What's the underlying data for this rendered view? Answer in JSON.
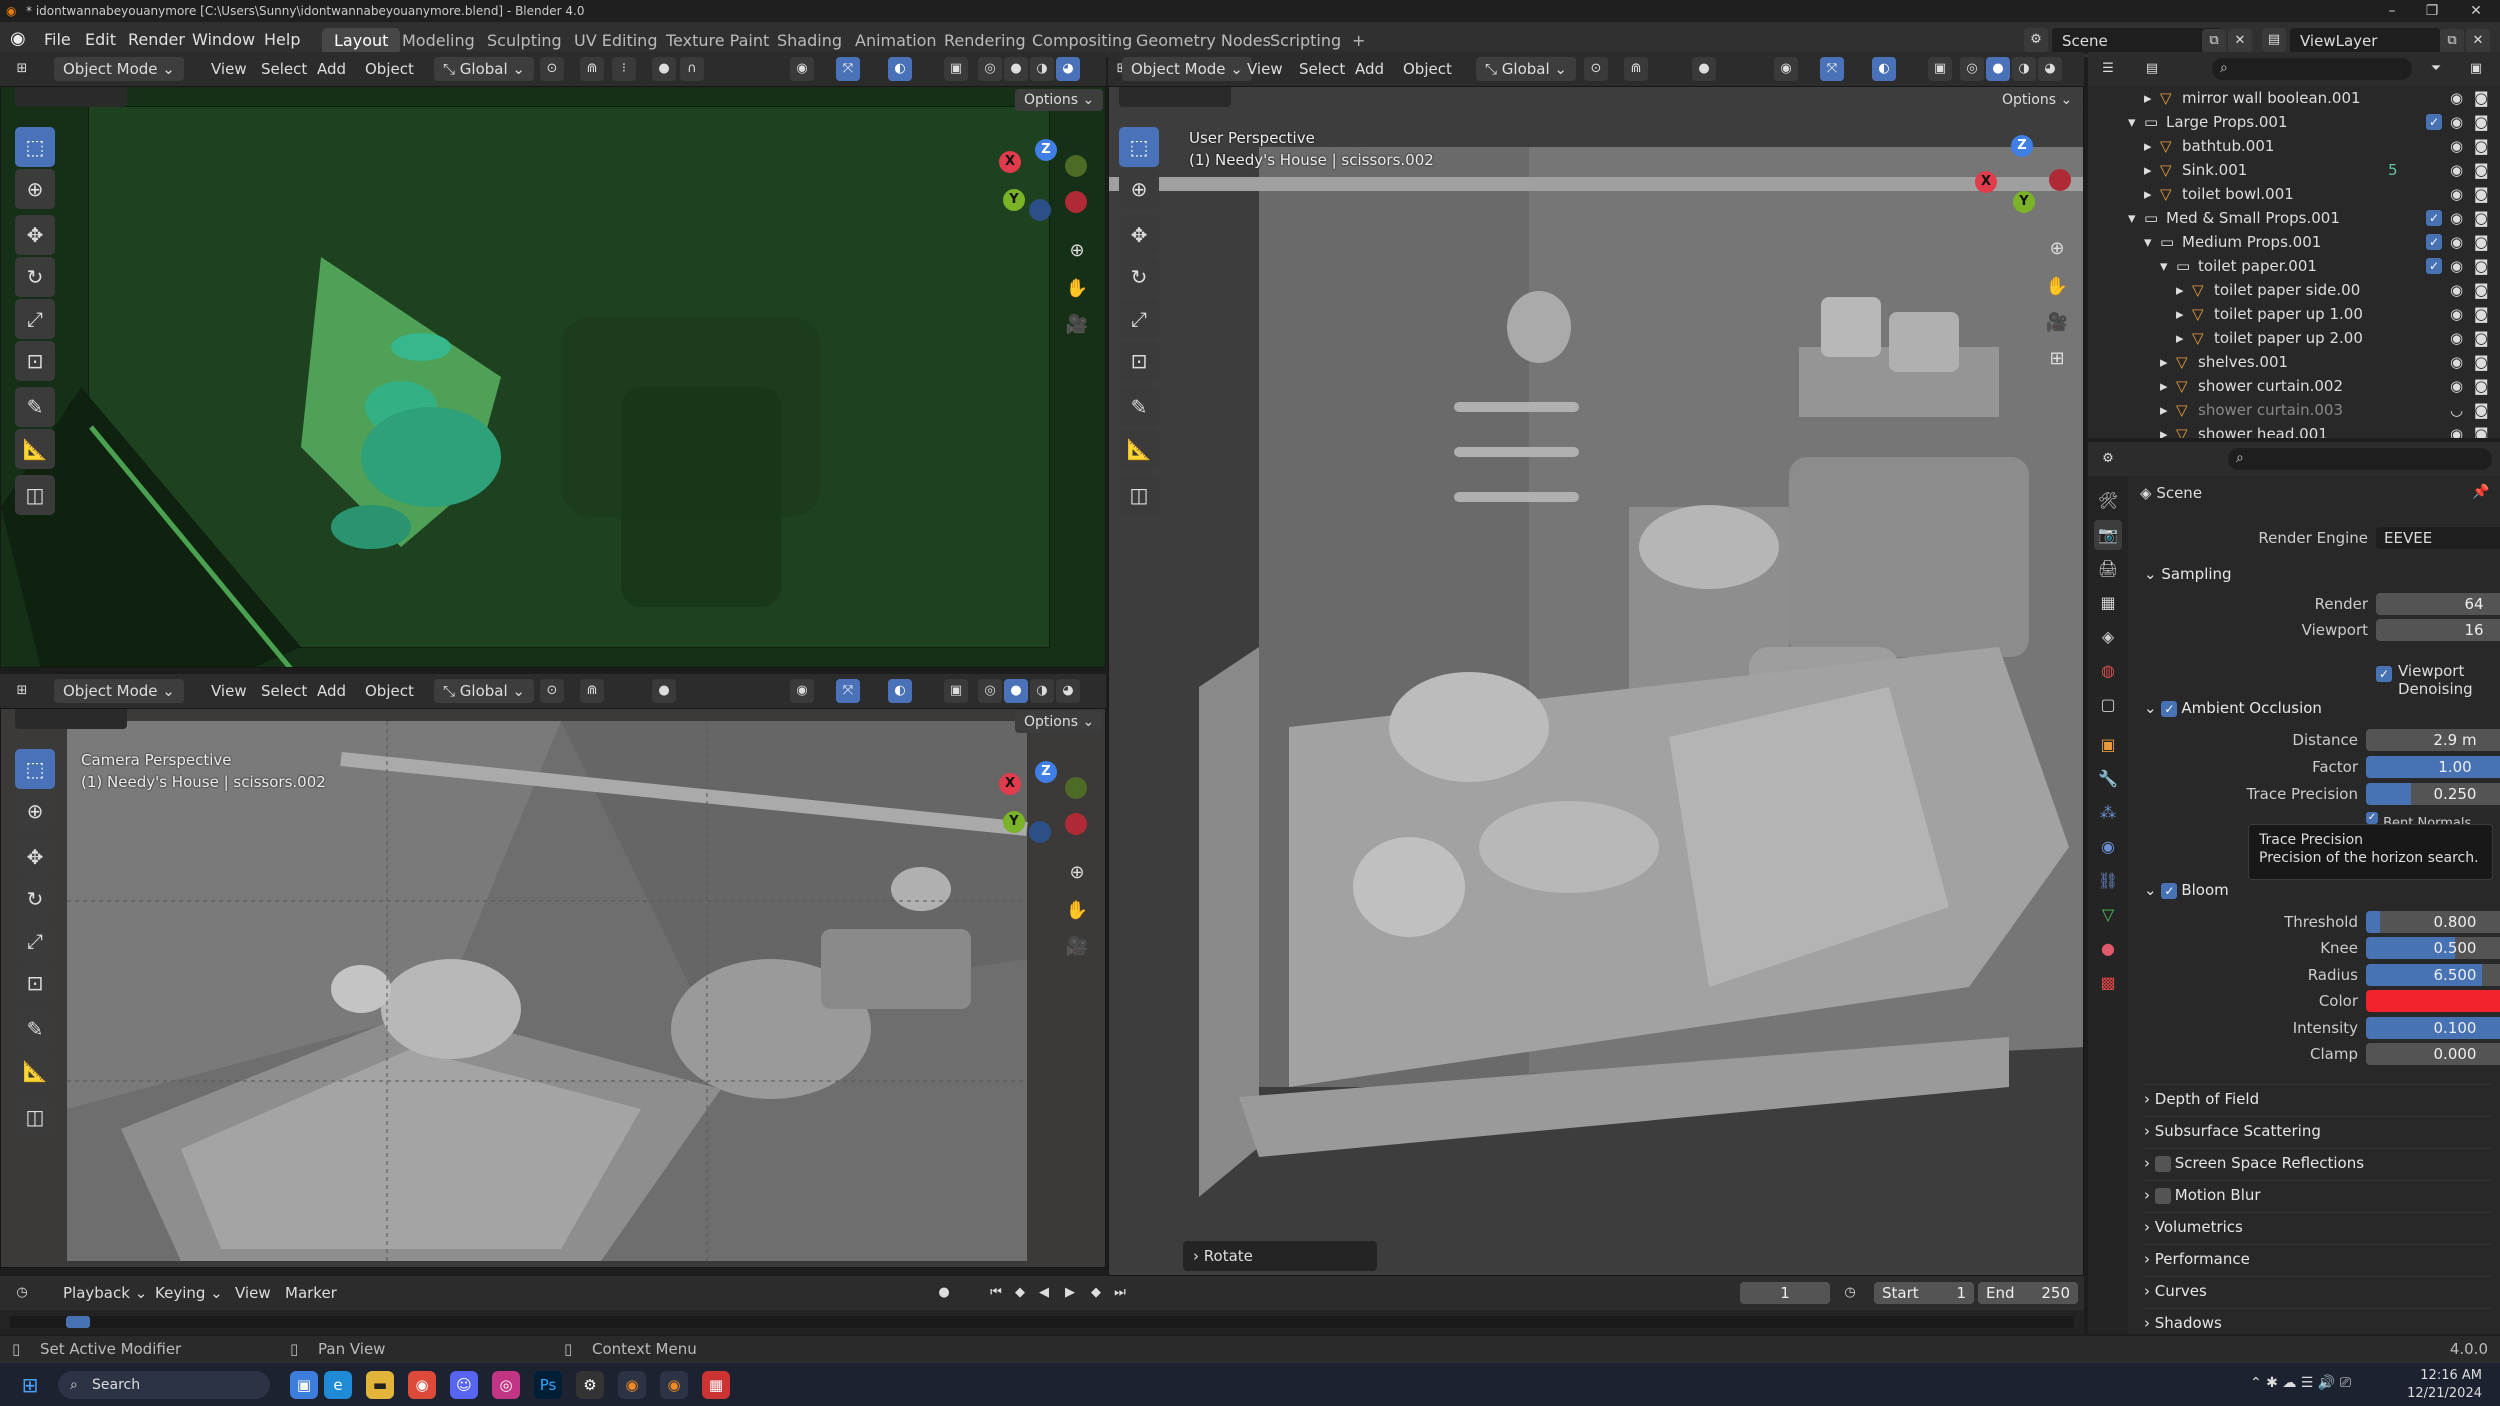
{
  "window": {
    "title": "* idontwannabeyouanymore [C:\\Users\\Sunny\\idontwannabeyouanymore.blend] - Blender 4.0",
    "controls": [
      "–",
      "❐",
      "✕"
    ]
  },
  "menu": [
    "File",
    "Edit",
    "Render",
    "Window",
    "Help"
  ],
  "workspaces": [
    {
      "label": "Layout",
      "active": true
    },
    {
      "label": "Modeling"
    },
    {
      "label": "Sculpting"
    },
    {
      "label": "UV Editing"
    },
    {
      "label": "Texture Paint"
    },
    {
      "label": "Shading"
    },
    {
      "label": "Animation"
    },
    {
      "label": "Rendering"
    },
    {
      "label": "Compositing"
    },
    {
      "label": "Geometry Nodes"
    },
    {
      "label": "Scripting"
    }
  ],
  "add_workspace": "+",
  "scene_selector": "Scene",
  "viewlayer_selector": "ViewLayer",
  "viewport_header": {
    "mode": "Object Mode",
    "menus": [
      "View",
      "Select",
      "Add",
      "Object"
    ],
    "orientation": "Global",
    "options": "Options"
  },
  "viewports": {
    "top_left": {
      "theme": "green"
    },
    "bottom_left": {
      "perspective": "Camera Perspective",
      "context": "(1) Needy's House | scissors.002"
    },
    "right": {
      "perspective": "User Perspective",
      "context": "(1) Needy's House | scissors.002"
    }
  },
  "gizmo": {
    "x": "X",
    "y": "Y",
    "z": "Z"
  },
  "last_operator": "Rotate",
  "outliner": {
    "rows": [
      {
        "indent": 3,
        "label": "mirror wall boolean.001",
        "type": "mesh"
      },
      {
        "indent": 2,
        "label": "Large Props.001",
        "type": "collection",
        "expanded": true
      },
      {
        "indent": 3,
        "label": "bathtub.001",
        "type": "mesh"
      },
      {
        "indent": 3,
        "label": "Sink.001",
        "type": "mesh",
        "badge": "5"
      },
      {
        "indent": 3,
        "label": "toilet bowl.001",
        "type": "mesh"
      },
      {
        "indent": 2,
        "label": "Med & Small Props.001",
        "type": "collection",
        "expanded": true
      },
      {
        "indent": 3,
        "label": "Medium Props.001",
        "type": "collection",
        "expanded": true
      },
      {
        "indent": 4,
        "label": "toilet paper.001",
        "type": "collection",
        "expanded": true
      },
      {
        "indent": 5,
        "label": "toilet paper side.00",
        "type": "mesh"
      },
      {
        "indent": 5,
        "label": "toilet paper up 1.00",
        "type": "mesh"
      },
      {
        "indent": 5,
        "label": "toilet paper up 2.00",
        "type": "mesh"
      },
      {
        "indent": 4,
        "label": "shelves.001",
        "type": "mesh"
      },
      {
        "indent": 4,
        "label": "shower curtain.002",
        "type": "mesh"
      },
      {
        "indent": 4,
        "label": "shower curtain.003",
        "type": "mesh",
        "dim": true
      },
      {
        "indent": 4,
        "label": "shower head.001",
        "type": "mesh"
      }
    ]
  },
  "properties": {
    "context": "Scene",
    "render_engine_label": "Render Engine",
    "render_engine": "EEVEE",
    "sampling": {
      "title": "Sampling",
      "render_label": "Render",
      "render": "64",
      "viewport_label": "Viewport",
      "viewport": "16",
      "denoise_label": "Viewport Denoising"
    },
    "ao": {
      "title": "Ambient Occlusion",
      "distance_label": "Distance",
      "distance": "2.9 m",
      "factor_label": "Factor",
      "factor": "1.00",
      "factor_fill": 1.0,
      "trace_label": "Trace Precision",
      "trace": "0.250",
      "trace_fill": 0.25,
      "bent_label": "Bent Normals"
    },
    "tooltip": {
      "title": "Trace Precision",
      "body": "Precision of the horizon search."
    },
    "bloom": {
      "title": "Bloom",
      "threshold_label": "Threshold",
      "threshold": "0.800",
      "threshold_fill": 0.08,
      "knee_label": "Knee",
      "knee": "0.500",
      "knee_fill": 0.5,
      "radius_label": "Radius",
      "radius": "6.500",
      "radius_fill": 0.65,
      "color_label": "Color",
      "color": "#f2232c",
      "intensity_label": "Intensity",
      "intensity": "0.100",
      "intensity_fill": 1.0,
      "clamp_label": "Clamp",
      "clamp": "0.000"
    },
    "collapsed": [
      "Depth of Field",
      "Subsurface Scattering",
      "Screen Space Reflections",
      "Motion Blur",
      "Volumetrics",
      "Performance",
      "Curves",
      "Shadows"
    ]
  },
  "timeline": {
    "menus": [
      "Playback",
      "Keying",
      "View",
      "Marker"
    ],
    "current_frame": "1",
    "start_label": "Start",
    "start": "1",
    "end_label": "End",
    "end": "250"
  },
  "statusbar": {
    "left": "Set Active Modifier",
    "middle": "Pan View",
    "right": "Context Menu",
    "version": "4.0.0"
  },
  "taskbar": {
    "search": "Search",
    "time": "12:16 AM",
    "date": "12/21/2024"
  },
  "colors": {
    "accent": "#4772b3",
    "bg": "#303030",
    "viewport_green": "#1b3d1c"
  }
}
